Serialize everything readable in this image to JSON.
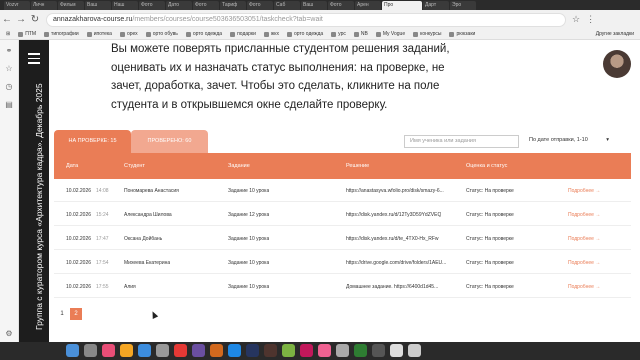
{
  "browser": {
    "tabs": [
      "Vozvr",
      "Личн",
      "Фильм",
      "Ваш",
      "Наш",
      "Фото",
      "Дато",
      "Фото",
      "Тариф",
      "Фото",
      "Саб",
      "Ваш",
      "Фото",
      "Арен",
      "Дарт",
      "Эро"
    ],
    "active_tab": "Про",
    "url_host": "annazakharova-course.ru",
    "url_path": "/members/courses/course503636503051/taskcheck?tab=wait",
    "bookmarks": [
      "ПТМ",
      "типографии",
      "ипотека",
      "орех",
      "орто обувь",
      "орто одежда",
      "подарки",
      "жкх",
      "орто одежда",
      "урс",
      "NB",
      "My Vogue",
      "конкурсы",
      "рюкзаки"
    ],
    "bookmarks_right": "Другие закладки"
  },
  "sidebar": {
    "title": "Группа с куратором курса «Архитектура кадра». Декабрь 2025"
  },
  "intro_text": "Вы можете поверять присланные студентом решения заданий, оценивать их и назначать статус выполнения: на проверке, не зачет, доработка, зачет. Чтобы это сделать, кликните на поле студента и в открывшемся окне сделайте проверку.",
  "tabs": {
    "pending": "НА ПРОВЕРКЕ: 15",
    "checked": "ПРОВЕРЕНО: 60"
  },
  "search_placeholder": "Имя ученика или задания",
  "sort_label": "По дате отправки, 1-10",
  "table": {
    "headers": [
      "Дата",
      "Студент",
      "Задание",
      "Решение",
      "Оценка и статус"
    ],
    "rows": [
      {
        "date": "10.02.2026",
        "time": "14:08",
        "student": "Пономарева Анастасия",
        "task": "Задание 10 урока",
        "solution": "https://anastasyva.wfolio.pro/disk/smazy-6...",
        "status": "Статус: На проверке",
        "action": "Подробнее →"
      },
      {
        "date": "10.02.2026",
        "time": "15:24",
        "student": "Александра Шилова",
        "task": "Задание 12 урока",
        "solution": "https://disk.yandex.ru/d/12Ty3D59YdZVEQ",
        "status": "Статус: На проверке",
        "action": "Подробнее →"
      },
      {
        "date": "10.02.2026",
        "time": "17:47",
        "student": "Оксана Дойбань",
        "task": "Задание 10 урока",
        "solution": "https://disk.yandex.ru/d/te_4TX0-Hx_RFw",
        "status": "Статус: На проверке",
        "action": "Подробнее →"
      },
      {
        "date": "10.02.2026",
        "time": "17:54",
        "student": "Михеева Екатерина",
        "task": "Задание 10 урока",
        "solution": "https://drive.google.com/drive/folders/1AEU...",
        "status": "Статус: На проверке",
        "action": "Подробнее →"
      },
      {
        "date": "10.02.2026",
        "time": "17:55",
        "student": "Алия",
        "task": "Задание 10 урока",
        "solution": "Домашнее задание.    https://6400d1d45...",
        "status": "Статус: На проверке",
        "action": "Подробнее →"
      }
    ]
  },
  "pagination": [
    "1",
    "2"
  ],
  "current_page": "2",
  "colors": {
    "accent": "#ea7d56",
    "accent_light": "#f2a890",
    "sidebar_bg": "#1d1d1d"
  }
}
